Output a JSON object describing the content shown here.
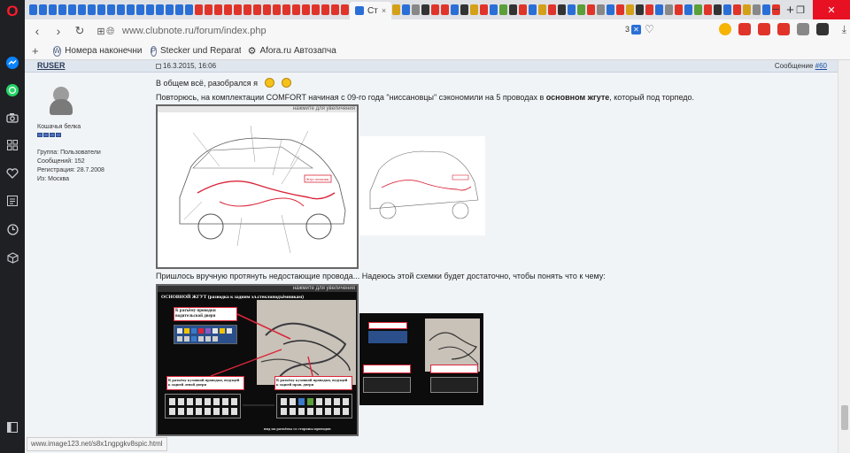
{
  "browser": {
    "active_tab_title": "Ст",
    "url": "www.clubnote.ru/forum/index.php",
    "url_badge_count": "3",
    "tab_favicon_colors": [
      "#2a6fd6",
      "#2a6fd6",
      "#2a6fd6",
      "#2a6fd6",
      "#2a6fd6",
      "#2a6fd6",
      "#2a6fd6",
      "#2a6fd6",
      "#2a6fd6",
      "#2a6fd6",
      "#2a6fd6",
      "#2a6fd6",
      "#2a6fd6",
      "#2a6fd6",
      "#2a6fd6",
      "#2a6fd6",
      "#2a6fd6",
      "#e0342a",
      "#e0342a",
      "#e0342a",
      "#e0342a",
      "#e0342a",
      "#e0342a",
      "#e0342a",
      "#e0342a",
      "#e0342a",
      "#e0342a",
      "#e0342a",
      "#e0342a",
      "#e0342a",
      "#e0342a",
      "#e0342a",
      "#e0342a"
    ],
    "tab_favicon_colors_right": [
      "#d4a017",
      "#2a6fd6",
      "#888",
      "#333",
      "#e0342a",
      "#e0342a",
      "#2a6fd6",
      "#333",
      "#d4a017",
      "#e0342a",
      "#2a6fd6",
      "#5a9f3a",
      "#333",
      "#e0342a",
      "#2a6fd6",
      "#d4a017",
      "#e0342a",
      "#333",
      "#2a6fd6",
      "#5a9f3a",
      "#e0342a",
      "#888",
      "#2a6fd6",
      "#e0342a",
      "#d4a017",
      "#333",
      "#e0342a",
      "#2a6fd6",
      "#888",
      "#e0342a",
      "#2a6fd6",
      "#5a9f3a",
      "#e0342a",
      "#333",
      "#2a6fd6",
      "#e0342a",
      "#d4a017",
      "#888",
      "#2a6fd6",
      "#e0342a"
    ],
    "extension_colors": [
      "#f4b400",
      "#e0342a",
      "#e0342a",
      "#e0342a",
      "#888888",
      "#333333"
    ],
    "bookmarks": [
      {
        "icon_letter": "W",
        "label": "Номера наконечни"
      },
      {
        "icon_letter": "P",
        "label": "Stecker und Reparat"
      },
      {
        "icon_letter": "⚙",
        "label": "Afora.ru Автозапча"
      }
    ]
  },
  "post": {
    "author": "RUSER",
    "date": "16.3.2015, 16:06",
    "post_number_prefix": "Сообщение ",
    "post_number_link": "#60",
    "rank": "Кошачья белка",
    "user_info": [
      "Группа: Пользователи",
      "Сообщений: 152",
      "Регистрация: 28.7.2008",
      "Из: Москва"
    ],
    "line1": "В общем всё, разобрался я",
    "line2_before": "Повторюсь, на комплектации COMFORT начиная с 09-го года \"ниссановцы\" сэкономили на 5 проводах в ",
    "line2_bold": "основном жгуте",
    "line2_after": ", который под торпедо.",
    "line3": "Пришлось вручную протянуть недостающие провода... Надеюсь этой схемки будет достаточно, чтобы понять что к чему:",
    "image_enlarge_label": "нажмите для увеличения",
    "diagram_red_label": "Жгут питания",
    "photo_title": "ОСНОВНОЙ ЖГУТ (разводка к задним эл.стеклоподъёмникам)",
    "photo_label_driver": "К разъёму проводки водительской двери",
    "photo_label_rear_left": "К разъёму кузовной проводки, ведущей к задней левой двери",
    "photo_label_rear_right": "К разъёму кузовной проводки, ведущей к задней прав. двери",
    "photo_bottom_caption": "вид на разъёмы со стороны проводов"
  },
  "status_url": "www.image123.net/s8x1ngpgkv8spic.html"
}
